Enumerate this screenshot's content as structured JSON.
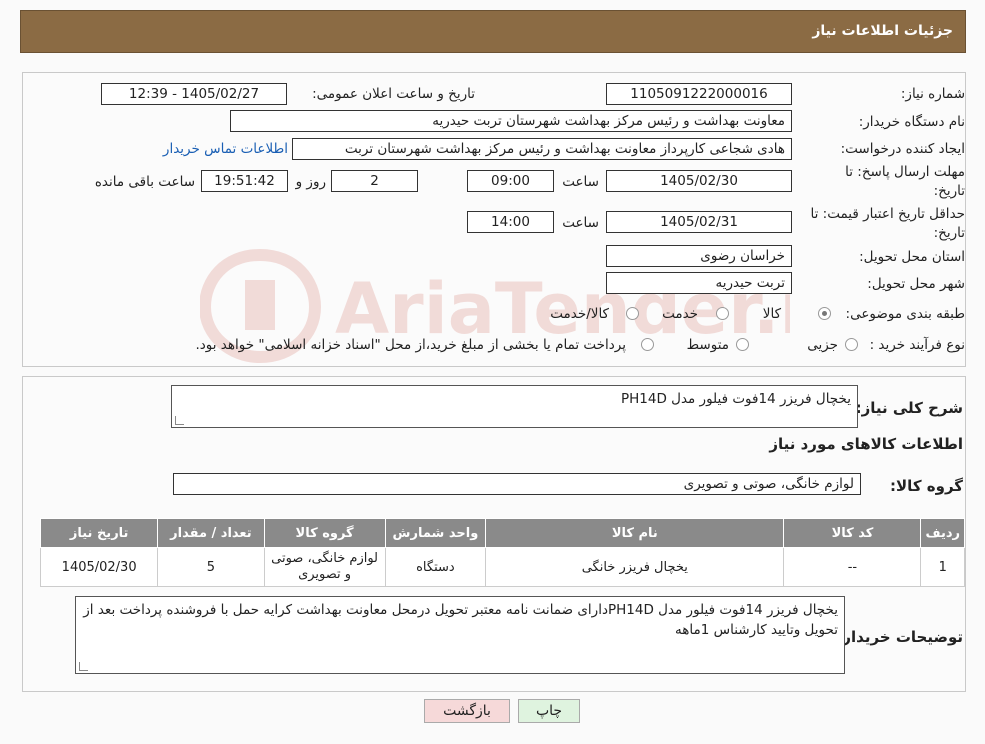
{
  "header": {
    "title": "جزئیات اطلاعات نیاز"
  },
  "form": {
    "need_number": {
      "label": "شماره نیاز:",
      "value": "1105091222000016"
    },
    "announce": {
      "label": "تاریخ و ساعت اعلان عمومی:",
      "value": "1405/02/27 - 12:39"
    },
    "buyer_org": {
      "label": "نام دستگاه خریدار:",
      "value": "معاونت بهداشت و رئیس مرکز بهداشت شهرستان تربت حیدریه"
    },
    "creator": {
      "label": "ایجاد کننده درخواست:",
      "value": "هادی شجاعی کارپرداز معاونت بهداشت و رئیس مرکز بهداشت شهرستان تربت",
      "link": "اطلاعات تماس خریدار"
    },
    "deadline": {
      "label_line1": "مهلت ارسال پاسخ: تا",
      "label_line2": "تاریخ:",
      "date": "1405/02/30",
      "time_label": "ساعت",
      "time": "09:00",
      "days": "2",
      "days_label": "روز و",
      "remaining": "19:51:42",
      "remaining_label": "ساعت باقی مانده"
    },
    "price_validity": {
      "label_line1": "حداقل تاریخ اعتبار قیمت: تا",
      "label_line2": "تاریخ:",
      "date": "1405/02/31",
      "time_label": "ساعت",
      "time": "14:00"
    },
    "province": {
      "label": "استان محل تحویل:",
      "value": "خراسان رضوی"
    },
    "city": {
      "label": "شهر محل تحویل:",
      "value": "تربت حیدریه"
    },
    "category": {
      "label": "طبقه بندی موضوعی:",
      "options": [
        "کالا",
        "خدمت",
        "کالا/خدمت"
      ],
      "selected": "کالا"
    },
    "process": {
      "label": "نوع فرآیند خرید :",
      "options": [
        "جزیی",
        "متوسط"
      ],
      "note": "پرداخت تمام یا بخشی از مبلغ خرید،از محل \"اسناد خزانه اسلامی\" خواهد بود."
    }
  },
  "description": {
    "label": "شرح کلی نیاز:",
    "value": "یخچال فریزر 14فوت فیلور مدل PH14D"
  },
  "goods_section": {
    "title": "اطلاعات کالاهای مورد نیاز"
  },
  "goods_group": {
    "label": "گروه کالا:",
    "value": "لوازم خانگی، صوتی و تصویری"
  },
  "table": {
    "headers": [
      "ردیف",
      "کد کالا",
      "نام کالا",
      "واحد شمارش",
      "گروه کالا",
      "تعداد / مقدار",
      "تاریخ نیاز"
    ],
    "rows": [
      [
        "1",
        "--",
        "یخچال فریزر خانگی",
        "دستگاه",
        "لوازم خانگی، صوتی و تصویری",
        "5",
        "1405/02/30"
      ]
    ]
  },
  "buyer_notes": {
    "label": "توضیحات خریدار:",
    "value": "یخچال فریزر 14فوت فیلور مدل PH14Dدارای ضمانت نامه معتبر تحویل درمحل معاونت بهداشت کرایه حمل با فروشنده پرداخت بعد از تحویل وتایید کارشناس 1ماهه"
  },
  "buttons": {
    "print": "چاپ",
    "back": "بازگشت"
  },
  "watermark": {
    "text": "AriaTender.neT"
  },
  "colors": {
    "header_bg": "#8b6b44",
    "table_header_bg": "#8a8a8a",
    "link": "#1a5fb4",
    "back_button_bg": "#f6d9d9",
    "print_button_bg": "#dff3df"
  }
}
